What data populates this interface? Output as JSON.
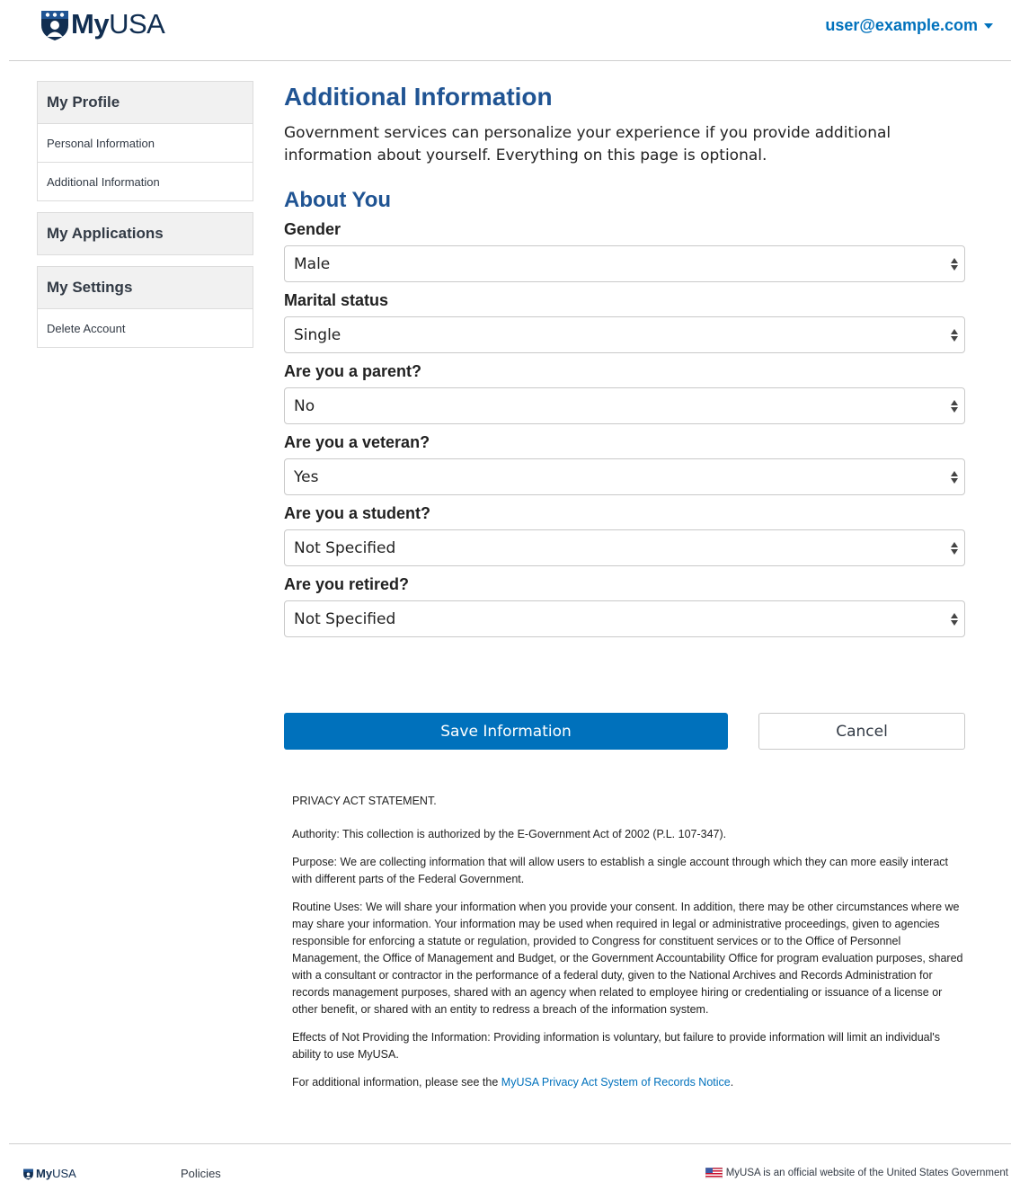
{
  "header": {
    "logo_my": "My",
    "logo_usa": "USA",
    "user_email": "user@example.com"
  },
  "sidebar": {
    "groups": [
      {
        "title": "My Profile",
        "items": [
          "Personal Information",
          "Additional Information"
        ]
      },
      {
        "title": "My Applications",
        "items": []
      },
      {
        "title": "My Settings",
        "items": [
          "Delete Account"
        ]
      }
    ]
  },
  "main": {
    "title": "Additional Information",
    "intro": "Government services can personalize your experience if you provide additional information about yourself. Everything on this page is optional.",
    "section_title": "About You",
    "fields": [
      {
        "label": "Gender",
        "value": "Male"
      },
      {
        "label": "Marital status",
        "value": "Single"
      },
      {
        "label": "Are you a parent?",
        "value": "No"
      },
      {
        "label": "Are you a veteran?",
        "value": "Yes"
      },
      {
        "label": "Are you a student?",
        "value": "Not Specified"
      },
      {
        "label": "Are you retired?",
        "value": "Not Specified"
      }
    ],
    "save_label": "Save Information",
    "cancel_label": "Cancel"
  },
  "privacy": {
    "title": "PRIVACY ACT STATEMENT.",
    "authority": "Authority: This collection is authorized by the E-Government Act of 2002 (P.L. 107-347).",
    "purpose": "Purpose: We are collecting information that will allow users to establish a single account through which they can more easily interact with different parts of the Federal Government.",
    "routine_uses": "Routine Uses: We will share your information when you provide your consent. In addition, there may be other circumstances where we may share your information. Your information may be used when required in legal or administrative proceedings, given to agencies responsible for enforcing a statute or regulation, provided to Congress for constituent services or to the Office of Personnel Management, the Office of Management and Budget, or the Government Accountability Office for program evaluation purposes, shared with a consultant or contractor in the performance of a federal duty, given to the National Archives and Records Administration for records management purposes, shared with an agency when related to employee hiring or credentialing or issuance of a license or other benefit, or shared with an entity to redress a breach of the information system.",
    "effects": "Effects of Not Providing the Information: Providing information is voluntary, but failure to provide information will limit an individual's ability to use MyUSA.",
    "more_prefix": "For additional information, please see the ",
    "more_link": "MyUSA Privacy Act System of Records Notice",
    "more_suffix": "."
  },
  "footer": {
    "logo_my": "My",
    "logo_usa": "USA",
    "policies": "Policies",
    "official": "MyUSA is an official website of the United States Government"
  },
  "colors": {
    "brand_navy": "#112e51",
    "heading_blue": "#205493",
    "link_blue": "#0071bc",
    "button_blue": "#0071bc"
  },
  "icons": [
    "myusa-shield-logo-icon",
    "caret-down-icon",
    "select-arrows-icon",
    "us-flag-icon"
  ]
}
